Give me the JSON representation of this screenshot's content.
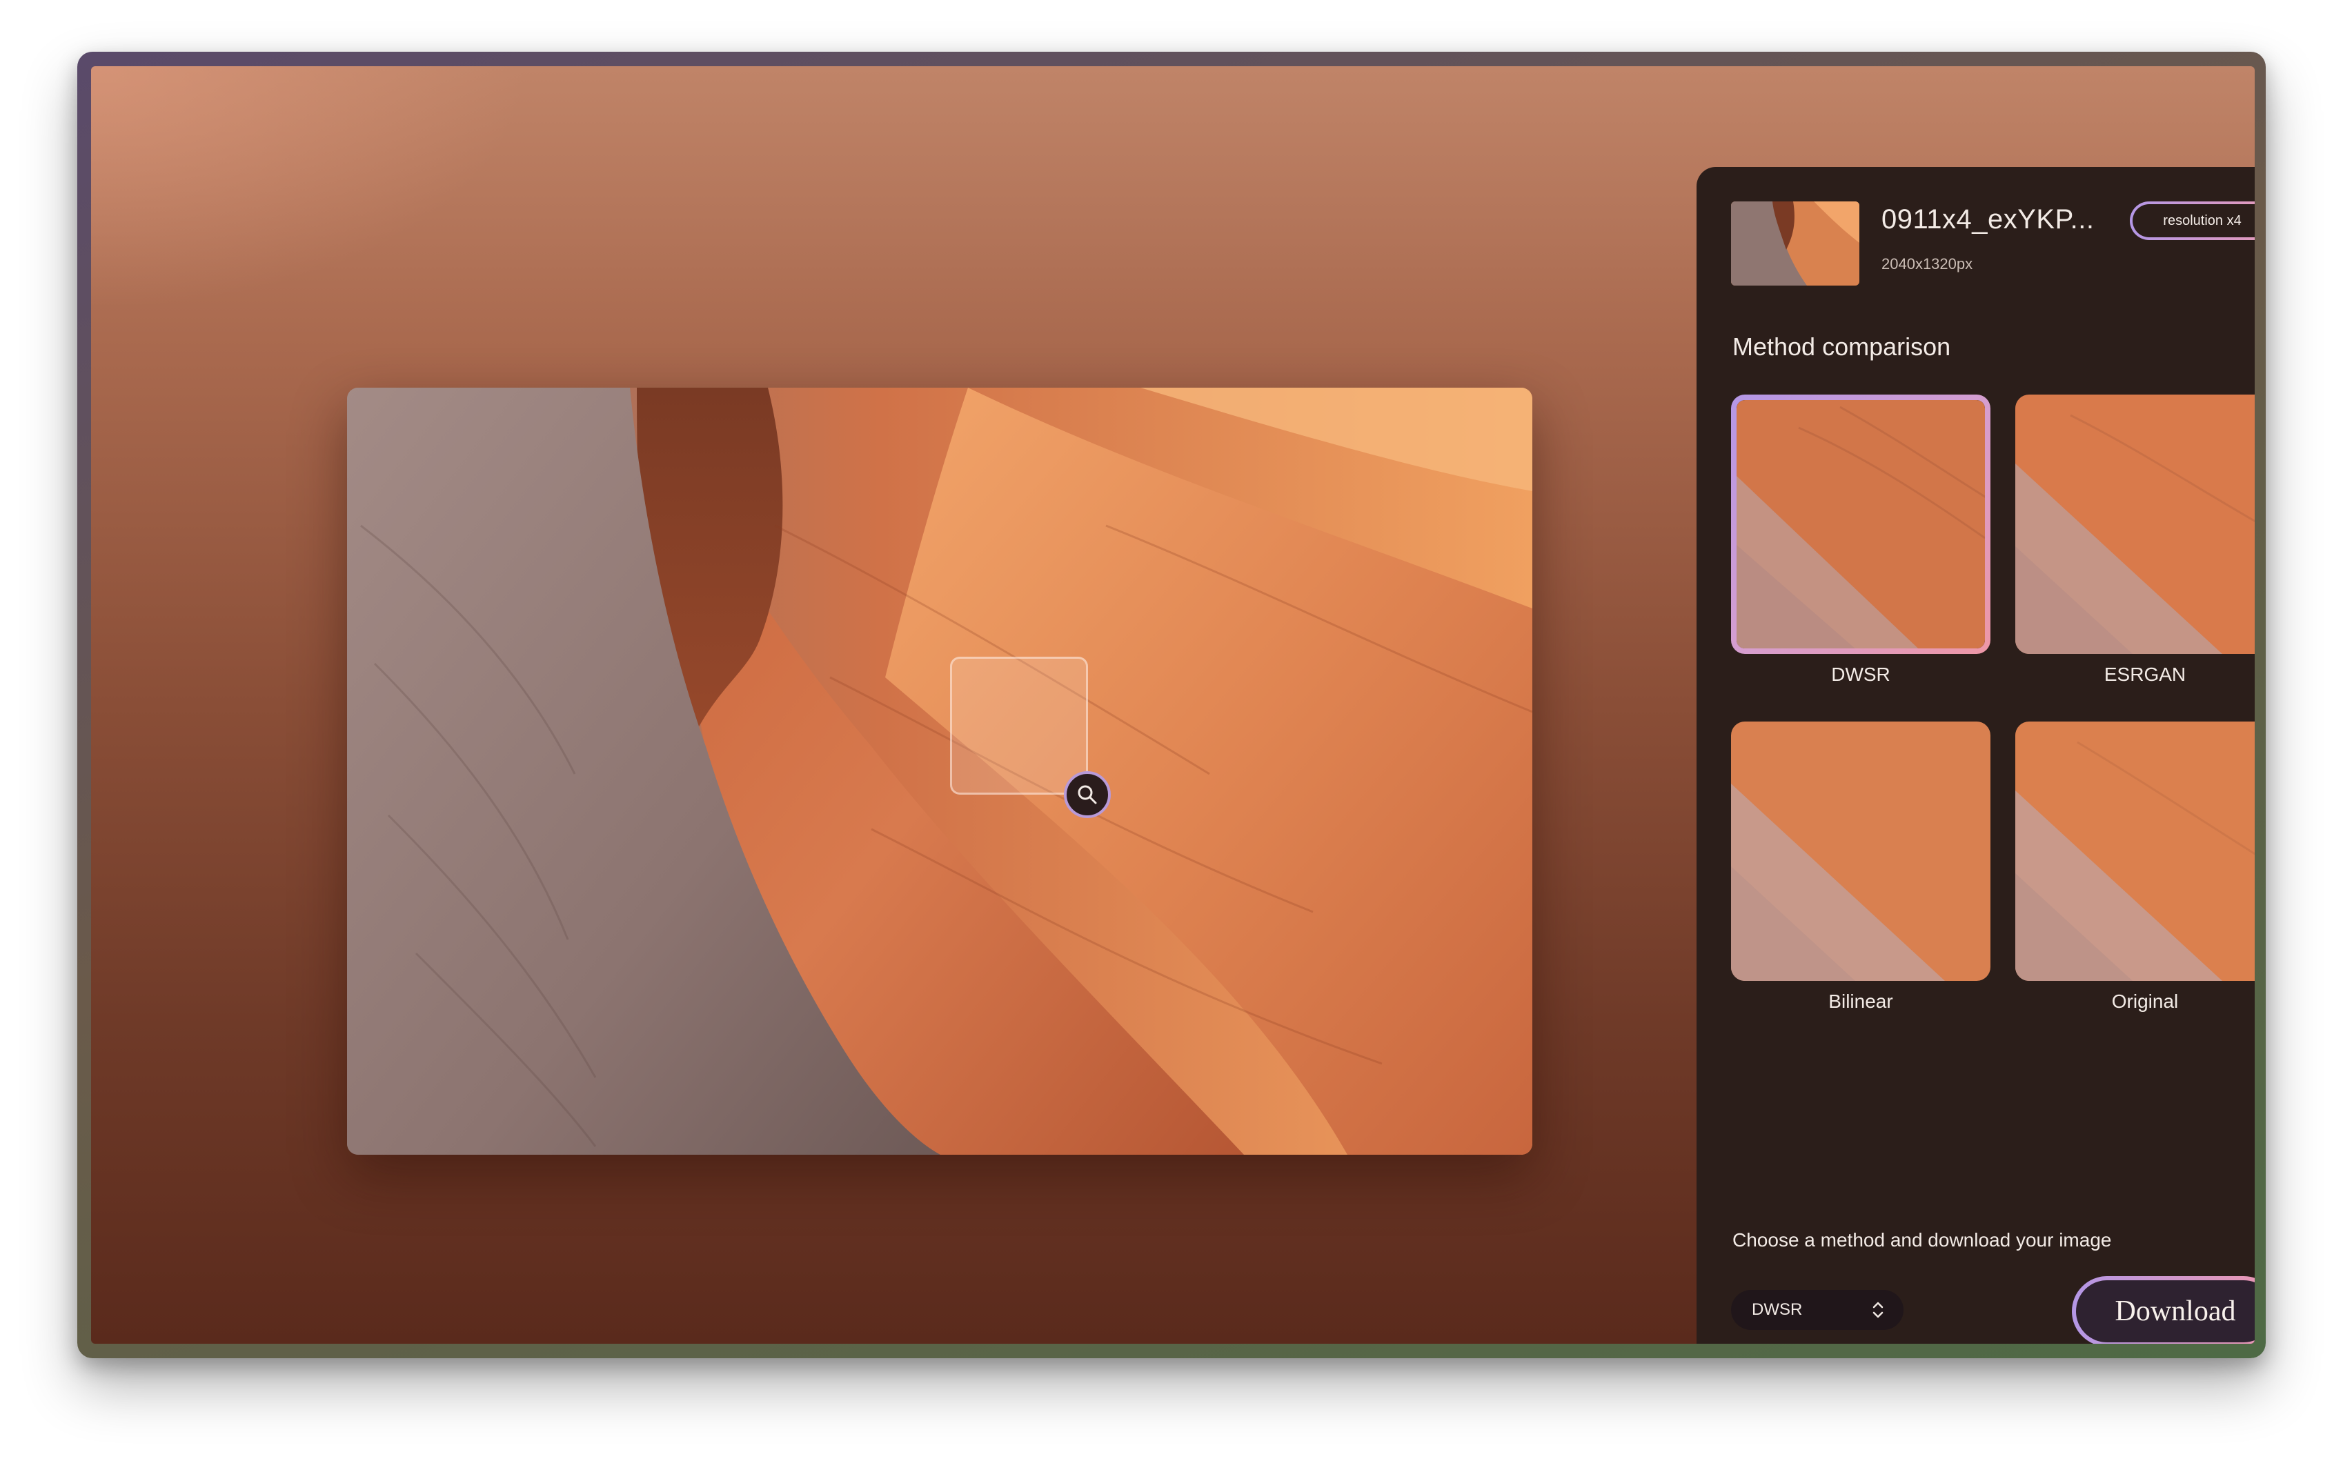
{
  "file": {
    "name": "0911x4_exYKP...",
    "dimensions": "2040x1320px",
    "badge": "resolution x4"
  },
  "panel": {
    "section_title": "Method comparison",
    "methods": [
      {
        "label": "DWSR",
        "selected": true
      },
      {
        "label": "ESRGAN",
        "selected": false
      },
      {
        "label": "Bilinear",
        "selected": false
      },
      {
        "label": "Original",
        "selected": false
      }
    ],
    "hint": "Choose a method and download your image",
    "select_value": "DWSR",
    "download_label": "Download"
  },
  "icons": {
    "zoom": "magnifier-icon",
    "select": "chevron-up-down-icon"
  },
  "colors": {
    "panel_bg": "#2b1e1a",
    "accent_start": "#b497e6",
    "accent_end": "#ee97a6"
  }
}
